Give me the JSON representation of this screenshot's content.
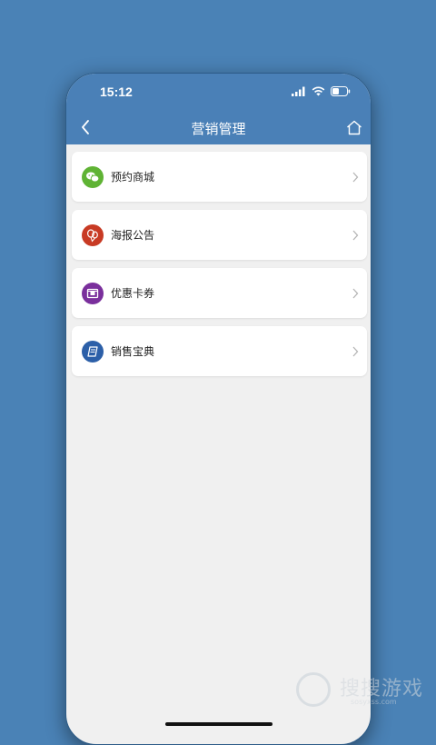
{
  "status_bar": {
    "time": "15:12"
  },
  "header": {
    "title": "营销管理"
  },
  "menu": {
    "items": [
      {
        "label": "预约商城",
        "icon": "wechat-icon",
        "color": "#5fb334"
      },
      {
        "label": "海报公告",
        "icon": "balloon-icon",
        "color": "#c83a24"
      },
      {
        "label": "优惠卡券",
        "icon": "coupon-icon",
        "color": "#7a2f9c"
      },
      {
        "label": "销售宝典",
        "icon": "book-icon",
        "color": "#2c5fa8"
      }
    ]
  },
  "colors": {
    "background": "#4a82b6",
    "header": "#4a80b7",
    "content_bg": "#f0f0f0"
  },
  "watermark": {
    "text": "搜搜游戏",
    "url": "sosyxss.com"
  }
}
